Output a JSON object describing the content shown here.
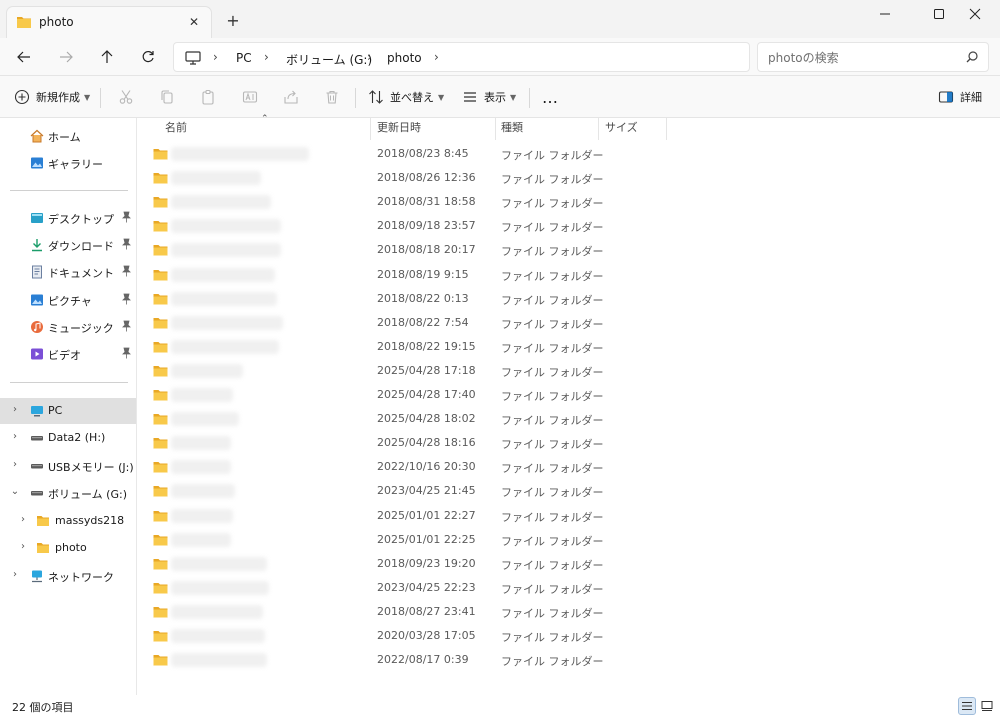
{
  "window": {
    "tab_title": "photo",
    "new_tab": "+"
  },
  "nav": {
    "breadcrumb": [
      "PC",
      "ボリューム (G:)",
      "photo"
    ],
    "search_placeholder": "photoの検索"
  },
  "toolbar": {
    "new_label": "新規作成",
    "sort_label": "並べ替え",
    "view_label": "表示",
    "more_label": "…",
    "details_label": "詳細"
  },
  "sidebar": {
    "quick": [
      {
        "label": "ホーム",
        "icon": "home-icon"
      },
      {
        "label": "ギャラリー",
        "icon": "gallery-icon"
      }
    ],
    "pinned": [
      {
        "label": "デスクトップ",
        "icon": "desktop-icon"
      },
      {
        "label": "ダウンロード",
        "icon": "download-icon"
      },
      {
        "label": "ドキュメント",
        "icon": "document-icon"
      },
      {
        "label": "ピクチャ",
        "icon": "pictures-icon"
      },
      {
        "label": "ミュージック",
        "icon": "music-icon"
      },
      {
        "label": "ビデオ",
        "icon": "video-icon"
      }
    ],
    "tree": [
      {
        "label": "PC",
        "icon": "pc-icon",
        "expander": "›",
        "selected": true
      },
      {
        "label": "Data2 (H:)",
        "icon": "drive-icon",
        "expander": "›"
      },
      {
        "label": "USBメモリー (J:)",
        "icon": "drive-icon",
        "expander": "›"
      },
      {
        "label": "ボリューム (G:)",
        "icon": "drive-icon",
        "expander": "⌄"
      },
      {
        "label": "massyds218",
        "icon": "folder-icon",
        "expander": "›",
        "child": true
      },
      {
        "label": "photo",
        "icon": "folder-icon",
        "expander": "›",
        "child": true
      },
      {
        "label": "ネットワーク",
        "icon": "network-icon",
        "expander": "›"
      }
    ]
  },
  "columns": {
    "name": "名前",
    "modified": "更新日時",
    "type": "種類",
    "size": "サイズ"
  },
  "files": [
    {
      "modified": "2018/08/23 8:45",
      "type": "ファイル フォルダー"
    },
    {
      "modified": "2018/08/26 12:36",
      "type": "ファイル フォルダー"
    },
    {
      "modified": "2018/08/31 18:58",
      "type": "ファイル フォルダー"
    },
    {
      "modified": "2018/09/18 23:57",
      "type": "ファイル フォルダー"
    },
    {
      "modified": "2018/08/18 20:17",
      "type": "ファイル フォルダー"
    },
    {
      "modified": "2018/08/19 9:15",
      "type": "ファイル フォルダー"
    },
    {
      "modified": "2018/08/22 0:13",
      "type": "ファイル フォルダー"
    },
    {
      "modified": "2018/08/22 7:54",
      "type": "ファイル フォルダー"
    },
    {
      "modified": "2018/08/22 19:15",
      "type": "ファイル フォルダー"
    },
    {
      "modified": "2025/04/28 17:18",
      "type": "ファイル フォルダー"
    },
    {
      "modified": "2025/04/28 17:40",
      "type": "ファイル フォルダー"
    },
    {
      "modified": "2025/04/28 18:02",
      "type": "ファイル フォルダー"
    },
    {
      "modified": "2025/04/28 18:16",
      "type": "ファイル フォルダー"
    },
    {
      "modified": "2022/10/16 20:30",
      "type": "ファイル フォルダー"
    },
    {
      "modified": "2023/04/25 21:45",
      "type": "ファイル フォルダー"
    },
    {
      "modified": "2025/01/01 22:27",
      "type": "ファイル フォルダー"
    },
    {
      "modified": "2025/01/01 22:25",
      "type": "ファイル フォルダー"
    },
    {
      "modified": "2018/09/23 19:20",
      "type": "ファイル フォルダー"
    },
    {
      "modified": "2023/04/25 22:23",
      "type": "ファイル フォルダー"
    },
    {
      "modified": "2018/08/27 23:41",
      "type": "ファイル フォルダー"
    },
    {
      "modified": "2020/03/28 17:05",
      "type": "ファイル フォルダー"
    },
    {
      "modified": "2022/08/17 0:39",
      "type": "ファイル フォルダー"
    }
  ],
  "status": {
    "item_count": "22 個の項目"
  },
  "colors": {
    "folder": "#f8c94a",
    "folder_dark": "#e9a825",
    "selected_bg": "#e0e0e0",
    "accent": "#0067c0"
  }
}
